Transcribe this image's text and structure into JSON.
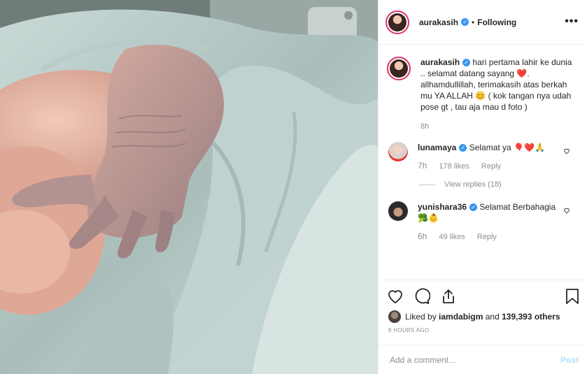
{
  "post": {
    "author": "aurakasih",
    "follow_status": "Following",
    "separator": "•",
    "more": "•••"
  },
  "caption": {
    "username": "aurakasih",
    "text_part1": "hari pertama lahir ke dunia .. selamat datang sayang ",
    "emoji_heart": "❤️",
    "text_part2": ". allhamdullillah, terimakasih atas berkah mu YA ALLAH ",
    "emoji_smile": "😊",
    "text_part3": " ( kok tangan nya udah pose gt , tau aja mau d foto )",
    "time": "8h"
  },
  "comments": [
    {
      "username": "lunamaya",
      "text": "Selamat ya 🎈❤️🙏",
      "time": "7h",
      "likes": "178 likes",
      "reply": "Reply",
      "view_replies": "View replies (18)"
    },
    {
      "username": "yunishara36",
      "text": "Selamat Berbahagia 🥦👶",
      "time": "6h",
      "likes": "49 likes",
      "reply": "Reply"
    }
  ],
  "likes": {
    "prefix": "Liked by ",
    "user": "iamdabigm",
    "middle": " and ",
    "count": "139,393 others"
  },
  "posted_ago": "8 HOURS AGO",
  "add_comment": {
    "placeholder": "Add a comment...",
    "post_label": "Post"
  },
  "colors": {
    "link_blue": "#3897f0",
    "post_disabled": "#b2dffc",
    "meta_gray": "#8e8e8e",
    "heart_red": "#e0245e"
  },
  "icons": [
    "heart-icon",
    "comment-icon",
    "share-icon",
    "bookmark-icon",
    "verified-icon",
    "more-icon"
  ]
}
